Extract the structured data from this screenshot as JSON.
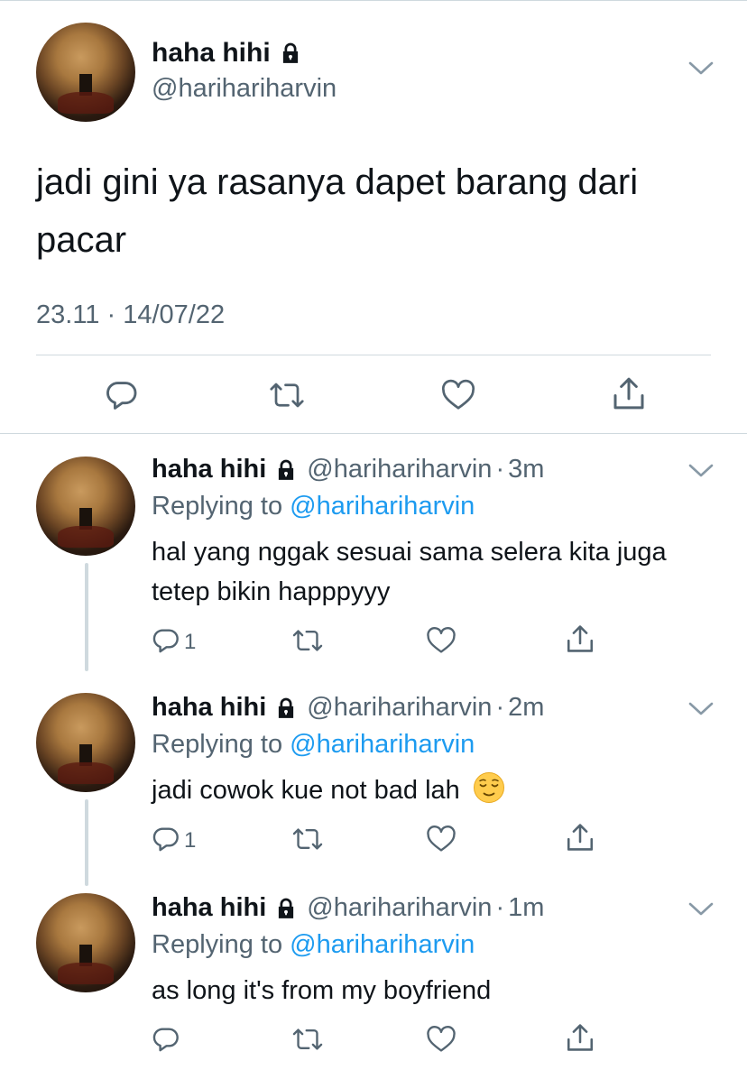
{
  "main_tweet": {
    "display_name": "haha hihi",
    "handle": "@harihariharvin",
    "text": "jadi gini ya rasanya dapet barang dari pacar",
    "timestamp": "23.11 · 14/07/22",
    "icons": {
      "reply": "reply-icon",
      "retweet": "retweet-icon",
      "like": "heart-icon",
      "share": "share-icon",
      "more": "chevron-down-icon",
      "protected": "lock-icon"
    }
  },
  "replies": [
    {
      "display_name": "haha hihi",
      "handle": "@harihariharvin",
      "separator": "·",
      "time": "3m",
      "replying_prefix": "Replying to",
      "replying_to": "@harihariharvin",
      "text": "hal yang nggak sesuai sama selera kita juga tetep bikin happpyyy",
      "reply_count": "1"
    },
    {
      "display_name": "haha hihi",
      "handle": "@harihariharvin",
      "separator": "·",
      "time": "2m",
      "replying_prefix": "Replying to",
      "replying_to": "@harihariharvin",
      "text": "jadi cowok kue not bad lah",
      "emoji": "relieved-face-emoji",
      "reply_count": "1"
    },
    {
      "display_name": "haha hihi",
      "handle": "@harihariharvin",
      "separator": "·",
      "time": "1m",
      "replying_prefix": "Replying to",
      "replying_to": "@harihariharvin",
      "text": "as long it's from my boyfriend",
      "reply_count": ""
    }
  ],
  "colors": {
    "text": "#0f1419",
    "secondary": "#536471",
    "link": "#1d9bf0",
    "divider": "#cfd9de"
  }
}
